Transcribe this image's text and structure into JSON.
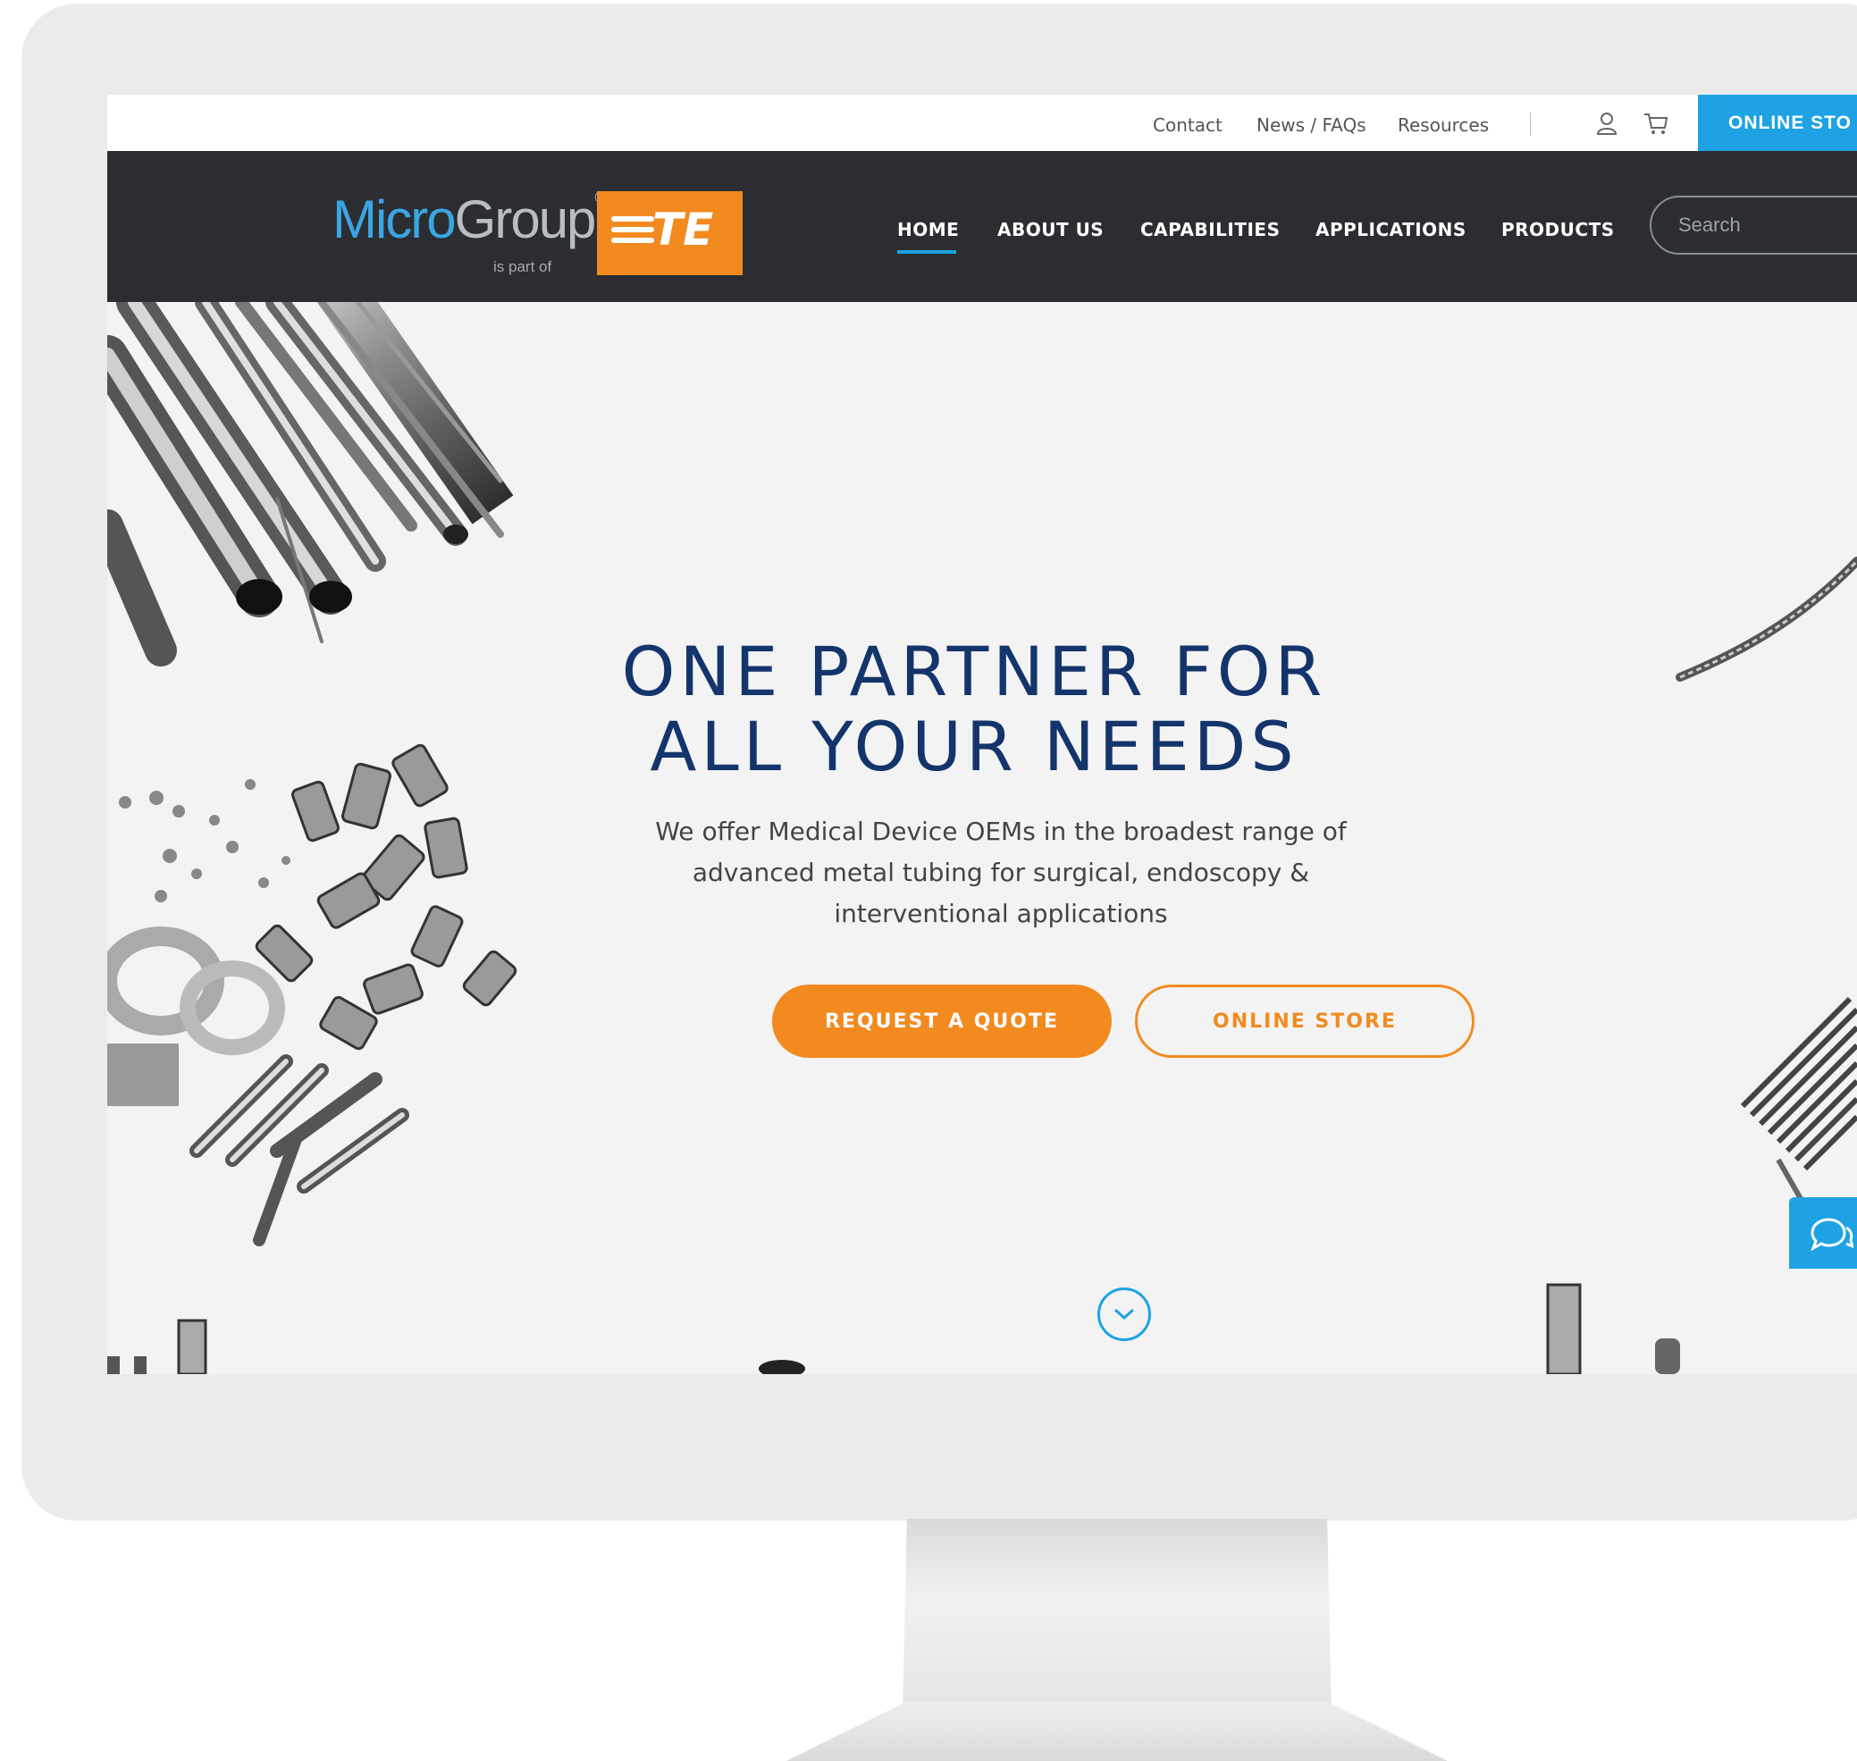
{
  "utility_bar": {
    "links": [
      "Contact",
      "News / FAQs",
      "Resources"
    ],
    "account_icon": "user-icon",
    "cart_icon": "cart-icon",
    "store_tab_label": "ONLINE STO"
  },
  "brand": {
    "logo_word_1": "Micro",
    "logo_word_2": "Group",
    "logo_trademark": "®",
    "logo_sub": "is part of",
    "partner_logo": "TE",
    "accent_color": "#f28a1f",
    "primary_color": "#1ea2e4"
  },
  "nav": {
    "items": [
      "HOME",
      "ABOUT US",
      "CAPABILITIES",
      "APPLICATIONS",
      "PRODUCTS"
    ],
    "active": "HOME",
    "search_placeholder": "Search"
  },
  "hero": {
    "title_line_1": "ONE PARTNER FOR",
    "title_line_2": "ALL YOUR NEEDS",
    "description": "We offer Medical Device OEMs in the broadest range of advanced metal tubing for surgical, endoscopy & interventional applications",
    "primary_button": "REQUEST A QUOTE",
    "secondary_button": "ONLINE STORE",
    "scroll_icon": "chevron-down-icon",
    "chat_icon": "chat-icon"
  }
}
